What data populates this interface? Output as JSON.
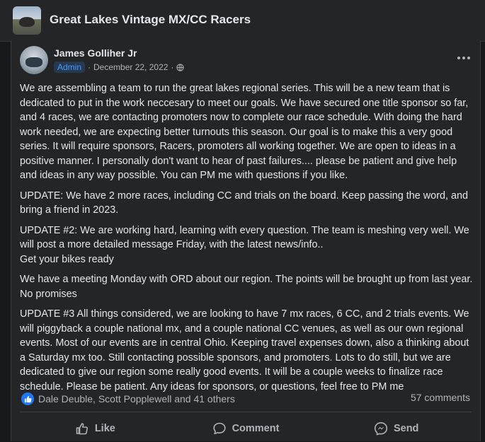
{
  "group": {
    "name": "Great Lakes Vintage MX/CC Racers"
  },
  "post": {
    "author": "James Golliher Jr",
    "role_badge": "Admin",
    "date": "December 22, 2022",
    "separator": "·",
    "paragraphs": [
      "We are assembling a team to run the great lakes regional series. This will be a new team that is dedicated to put in the work neccesary to meet our goals. We have secured one title sponsor so far, and 4 races, we are contacting promoters now to complete our race schedule. With doing the hard work needed, we are expecting better turnouts this season. Our goal is to make this a very good series. It will require sponsors, Racers, promoters all working together. We are open to ideas in a positive manner. I personally don't want to hear of past failures.... please be patient and give help and ideas in any way possible. You can PM me with questions if you like.",
      "UPDATE: We have 2 more races, including CC and trials on the board. Keep passing the word, and bring a friend in 2023.",
      "UPDATE #2: We are working hard, learning with every question. The team is meshing very well. We will post a more detailed message Friday, with the latest news/info..\nGet your bikes ready",
      "We have a meeting Monday with ORD about our region. The points will be brought up from last year. No promises",
      "UPDATE #3 All things considered, we are looking to have 7 mx races, 6 CC, and 2 trials events. We will piggyback a couple national mx, and a couple national CC venues, as well as our own regional events. Most of our events are in central Ohio. Keeping travel expenses down, also a thinking about a Saturday mx too. Still contacting possible sponsors, and promoters. Lots to do still, but we are dedicated to give our region some really good events. It will be a couple weeks to finalize race schedule. Please be patient. Any ideas for sponsors, or questions, feel free to PM me"
    ],
    "reactions_text": "Dale Deuble, Scott Popplewell and 41 others",
    "comments_text": "57 comments"
  },
  "actions": {
    "like": "Like",
    "comment": "Comment",
    "send": "Send"
  },
  "icons": {
    "group_thumbnail": "group-photo",
    "avatar": "profile-photo",
    "audience": "globe-icon",
    "more": "more-options-icon",
    "reaction": "like-icon",
    "like": "thumbs-up-icon",
    "comment": "speech-bubble-icon",
    "send": "messenger-icon"
  },
  "colors": {
    "background": "#18191a",
    "surface": "#242526",
    "text_primary": "#e4e6eb",
    "text_secondary": "#b0b3b8",
    "accent": "#2078f4",
    "badge_bg": "#263951",
    "badge_text": "#4599ff"
  }
}
